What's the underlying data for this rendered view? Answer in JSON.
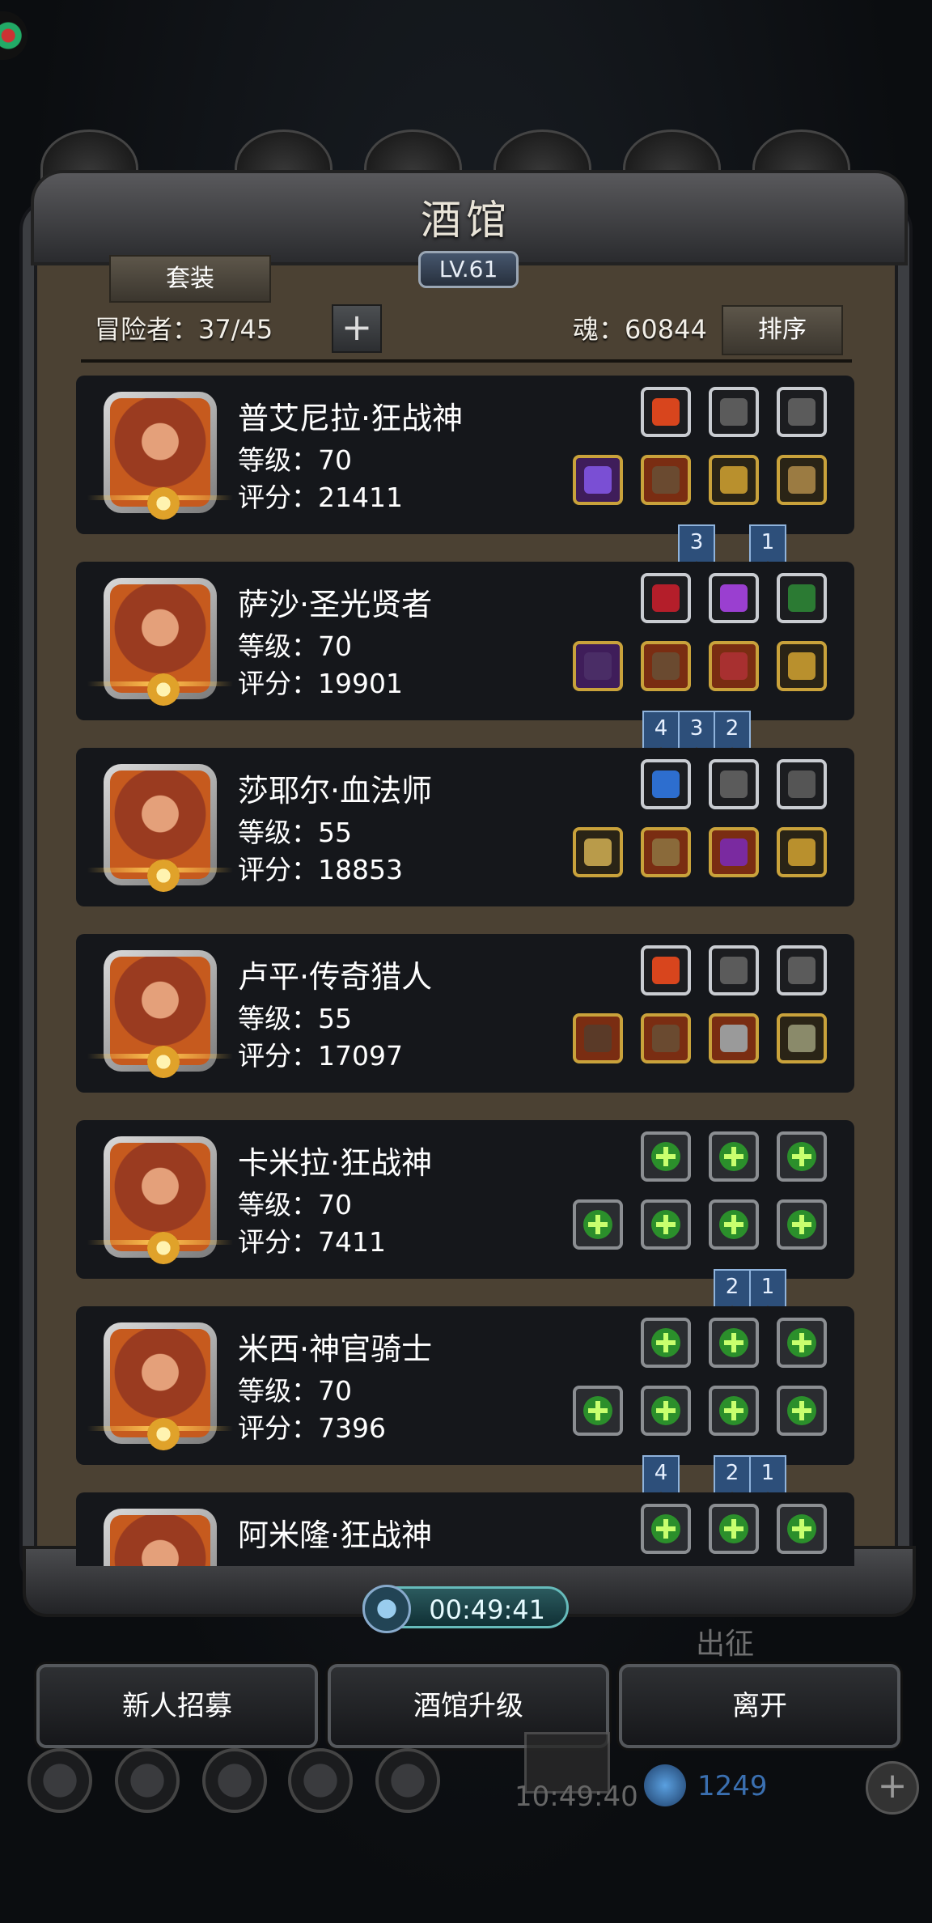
{
  "header": {
    "title": "酒馆",
    "level": "LV.61"
  },
  "toolbar": {
    "set_label": "套装",
    "adventurers_label": "冒险者：37/45",
    "plus_label": "+",
    "soul_label": "魂：60844",
    "sort_label": "排序"
  },
  "heroes": [
    {
      "name": "普艾尼拉·狂战神",
      "level": "等级：70",
      "score": "评分：21411",
      "top": [
        "fire",
        "feather",
        "feather"
      ],
      "bottom": [
        "purple-axe",
        "armor",
        "ring",
        "arm-guard"
      ],
      "ribbons": [
        "3",
        "1"
      ]
    },
    {
      "name": "萨沙·圣光贤者",
      "level": "等级：70",
      "score": "评分：19901",
      "top": [
        "heart",
        "gem",
        "scroll"
      ],
      "bottom": [
        "staff",
        "armor",
        "weapon",
        "ring"
      ],
      "ribbons": [
        "4",
        "3",
        "2"
      ]
    },
    {
      "name": "莎耶尔·血法师",
      "level": "等级：55",
      "score": "评分：18853",
      "top": [
        "orb",
        "feather",
        "mask"
      ],
      "bottom": [
        "mace",
        "robe",
        "amulet",
        "ring"
      ],
      "ribbons": []
    },
    {
      "name": "卢平·传奇猎人",
      "level": "等级：55",
      "score": "评分：17097",
      "top": [
        "fire",
        "feather",
        "feather"
      ],
      "bottom": [
        "gun",
        "armor",
        "helmet",
        "shield"
      ],
      "ribbons": []
    },
    {
      "name": "卡米拉·狂战神",
      "level": "等级：70",
      "score": "评分：7411",
      "top": [
        "add",
        "add",
        "add"
      ],
      "bottom": [
        "add",
        "add",
        "add",
        "add"
      ],
      "ribbons": [
        "2",
        "1"
      ]
    },
    {
      "name": "米西·神官骑士",
      "level": "等级：70",
      "score": "评分：7396",
      "top": [
        "add",
        "add",
        "add"
      ],
      "bottom": [
        "add",
        "add",
        "add",
        "add"
      ],
      "ribbons": [
        "4",
        "2",
        "1"
      ]
    },
    {
      "name": "阿米隆·狂战神",
      "level": "",
      "score": "",
      "top": [
        "add",
        "add",
        "add"
      ],
      "bottom": [],
      "ribbons": []
    }
  ],
  "timer": "00:49:41",
  "bottom_buttons": {
    "recruit": "新人招募",
    "upgrade": "酒馆升级",
    "leave": "离开"
  },
  "background": {
    "deploy_text": "出征",
    "clock": "10:49:40",
    "gems": "1249",
    "add_label": "+"
  },
  "colors": {
    "frame": "#3c3e42",
    "panel": "#4b4133",
    "card": "#15171b",
    "gold": "#c9a23b",
    "add_green": "#2b8f2b"
  }
}
